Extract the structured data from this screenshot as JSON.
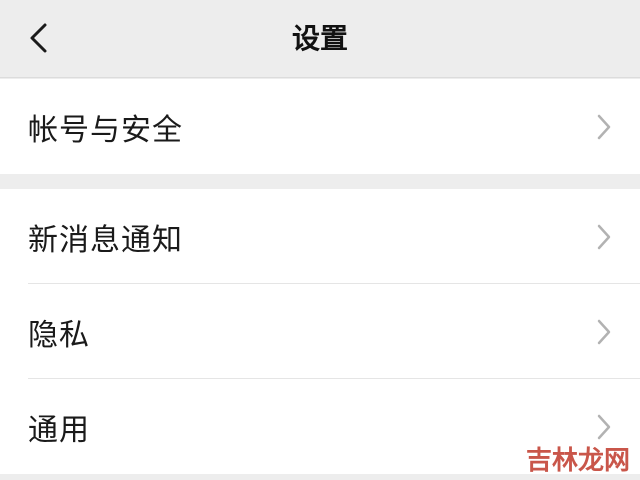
{
  "navbar": {
    "title": "设置",
    "back_icon": "chevron-left-icon"
  },
  "groups": [
    {
      "items": [
        {
          "label": "帐号与安全",
          "icon": "chevron-right-icon"
        }
      ]
    },
    {
      "items": [
        {
          "label": "新消息通知",
          "icon": "chevron-right-icon"
        },
        {
          "label": "隐私",
          "icon": "chevron-right-icon"
        },
        {
          "label": "通用",
          "icon": "chevron-right-icon"
        }
      ]
    }
  ],
  "watermark": {
    "text": "吉林龙网",
    "color": "#c0392b"
  },
  "colors": {
    "background": "#ededed",
    "row_background": "#ffffff",
    "text": "#1a1a1a",
    "chevron": "#b2b2b2"
  }
}
